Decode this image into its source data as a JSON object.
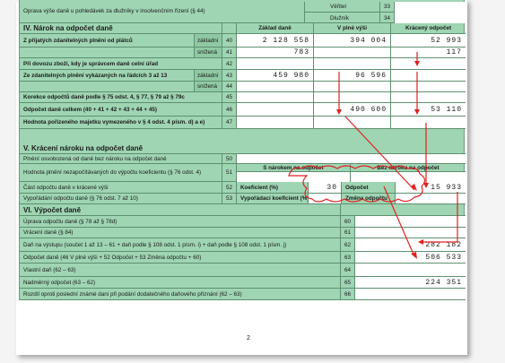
{
  "top": {
    "row44_label": "Oprava výše daně u pohledávek za dlužníky v insolvenčním řízení (§ 44)",
    "veritel_label": "Věřitel",
    "veritel_num": "33",
    "dluznik_label": "Dlužník",
    "dluznik_num": "34"
  },
  "section4": {
    "title": "IV. Nárok na odpočet daně",
    "col_base": "Základ daně",
    "col_full": "V plné výši",
    "col_reduced": "Krácený odpočet",
    "rows": [
      {
        "label": "Z přijatých zdanitelných plnění od plátců",
        "sub": "základní",
        "num": "40",
        "base": "2 128 558",
        "full": "394 004",
        "reduced": "52 993"
      },
      {
        "label": "",
        "sub": "snížená",
        "num": "41",
        "base": "783",
        "full": "",
        "reduced": "117"
      },
      {
        "label": "Při dovozu zboží, kdy je správcem daně celní úřad",
        "sub": "",
        "num": "42",
        "base": "",
        "full": "",
        "reduced": ""
      },
      {
        "label": "Ze zdanitelných plnění vykázaných na řádcích 3 až 13",
        "sub": "základní",
        "num": "43",
        "base": "459 980",
        "full": "96 596",
        "reduced": ""
      },
      {
        "label": "",
        "sub": "snížená",
        "num": "44",
        "base": "",
        "full": "",
        "reduced": ""
      },
      {
        "label": "Korekce odpočtů daně podle § 75 odst. 4, § 77, § 79 až § 79c",
        "sub": "",
        "num": "45",
        "base": "",
        "full": "",
        "reduced": ""
      },
      {
        "label": "Odpočet daně celkem (40 + 41 + 42 + 43 + 44 + 45)",
        "sub": "",
        "num": "46",
        "base": "",
        "full": "490 600",
        "reduced": "53 110"
      },
      {
        "label": "Hodnota pořízeného majetku vymezeného v § 4 odst. 4 písm. d) a e)",
        "sub": "",
        "num": "47",
        "base": "",
        "full": "",
        "reduced": ""
      }
    ]
  },
  "section5": {
    "title": "V. Krácení nároku na odpočet daně",
    "row50": {
      "label": "Plnění osvobozená od daně bez nároku na odpočet daně",
      "num": "50"
    },
    "row51": {
      "label": "Hodnota plnění nezapočítávaných do výpočtu koeficientu (§ 76 odst. 4)",
      "num": "51",
      "col_with": "S nárokem na odpočet",
      "col_without": "Bez nároku na odpočet"
    },
    "row52": {
      "label": "Část odpočtu daně v krácené výši",
      "num": "52",
      "coef_label": "Koeficient (%)",
      "coef_value": "30",
      "odpocet_label": "Odpočet",
      "odpocet_value": "15 933"
    },
    "row53": {
      "label": "Vypořádání odpočtu daně (§ 76 odst. 7 až 10)",
      "num": "53",
      "vyp_label": "Vypořádací koeficient (%)",
      "change_label": "Změna odpočtu"
    }
  },
  "section6": {
    "title": "VI. Výpočet daně",
    "rows": [
      {
        "label": "Úprava odpočtu daně (§ 78 až § 78d)",
        "num": "60",
        "value": ""
      },
      {
        "label": "Vrácení daně (§ 84)",
        "num": "61",
        "value": ""
      },
      {
        "label": "Daň na výstupu (součet 1 až 13 – 61 + daň podle § 108 odst. 1 písm. i) + daň podle § 108 odst. 1 písm. j)",
        "num": "62",
        "value": "282 182"
      },
      {
        "label": "Odpočet daně (46 V plné výši + 52 Odpočet + 53 Změna odpočtu + 60)",
        "num": "63",
        "value": "506 533"
      },
      {
        "label": "Vlastní daň (62 – 63)",
        "num": "64",
        "value": ""
      },
      {
        "label": "Nadměrný odpočet (63 – 62)",
        "num": "65",
        "value": "224 351"
      },
      {
        "label": "Rozdíl oproti poslední známé dani při podání dodatečného daňového přiznání (62 – 63)",
        "num": "66",
        "value": ""
      }
    ]
  },
  "page_number": "2",
  "colors": {
    "form_green": "#9fd5b3",
    "annotation_red": "#e02020",
    "border": "#5e8f70"
  }
}
